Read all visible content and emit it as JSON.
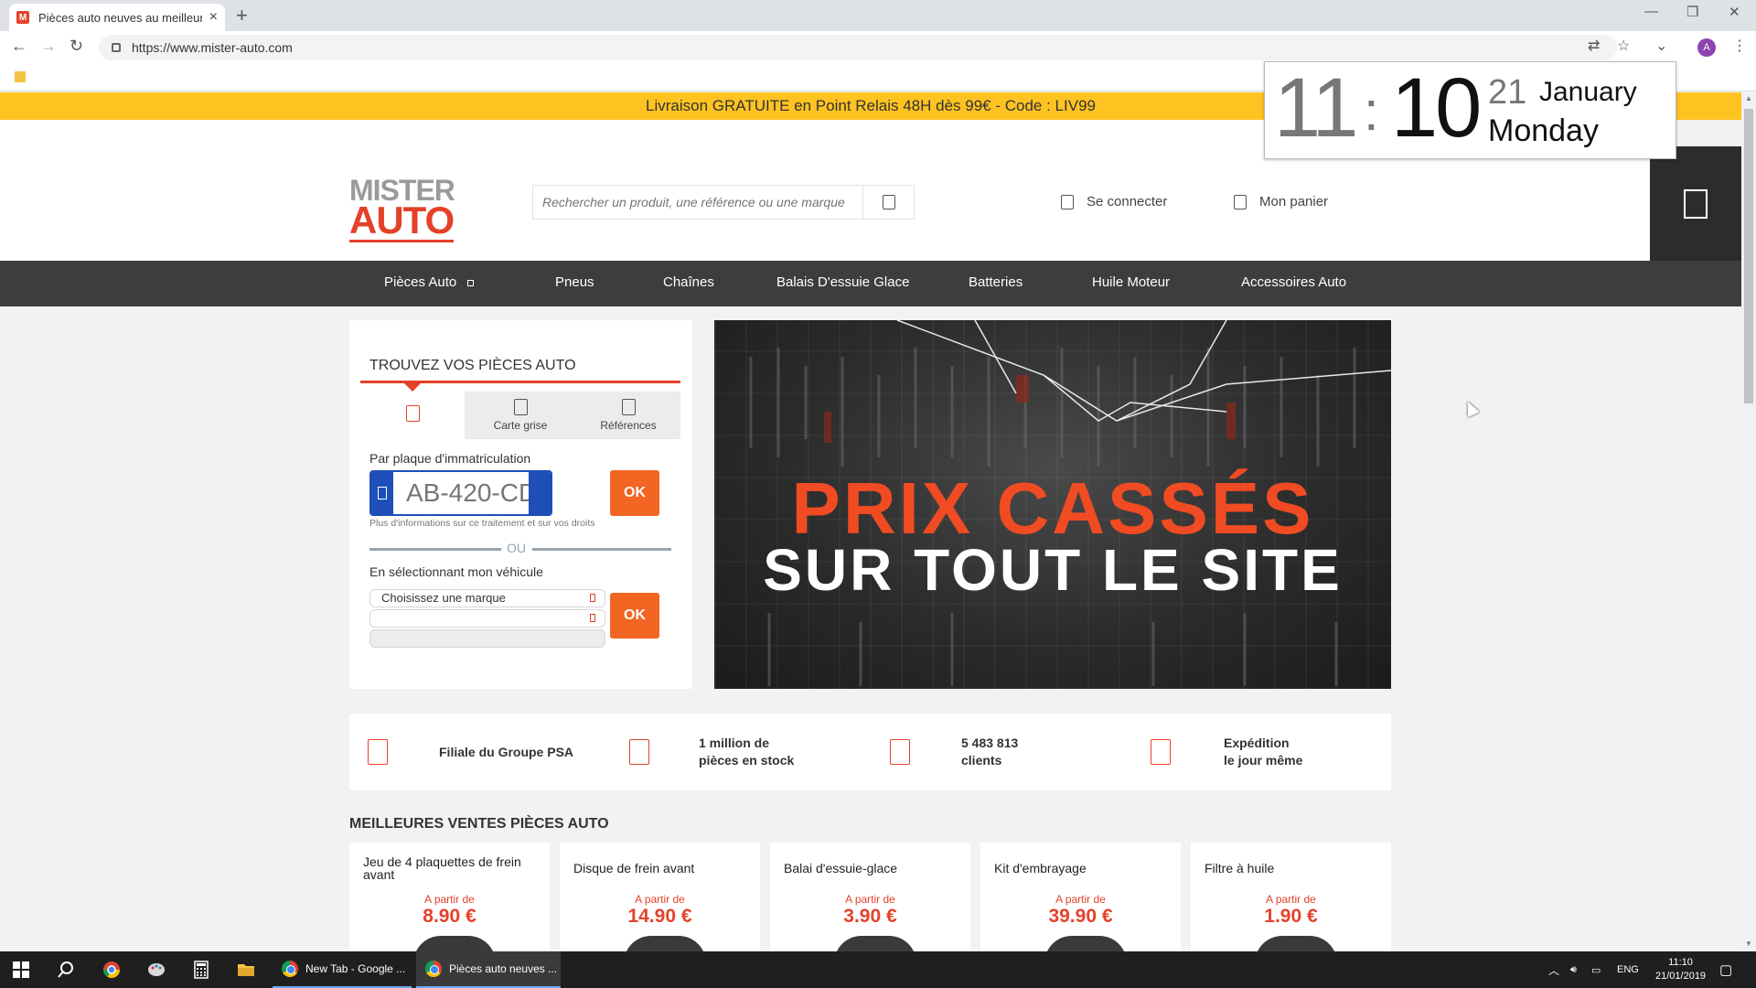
{
  "browser": {
    "tab_title": "Pièces auto neuves au meilleur p",
    "tab_favicon": "M",
    "url": "https://www.mister-auto.com",
    "profile_initial": "A"
  },
  "promo": {
    "text": "Livraison GRATUITE en Point Relais 48H dès 99€ - Code : LIV99"
  },
  "header": {
    "logo_line1": "MISTER",
    "logo_line2": "AUTO",
    "search_placeholder": "Rechercher un produit, une référence ou une marque",
    "login_label": "Se connecter",
    "cart_label": "Mon panier"
  },
  "nav": {
    "items": [
      "Pièces Auto",
      "Pneus",
      "Chaînes",
      "Balais D'essuie Glace",
      "Batteries",
      "Huile Moteur",
      "Accessoires Auto"
    ]
  },
  "finder": {
    "title": "TROUVEZ VOS PIÈCES AUTO",
    "tabs": [
      "",
      "Carte grise",
      "Références"
    ],
    "plate_label": "Par plaque d'immatriculation",
    "plate_placeholder": "AB-420-CD",
    "ok_label": "OK",
    "note": "Plus d'informations sur ce traitement et sur vos droits",
    "or_label": "OU",
    "vehicle_label": "En sélectionnant mon véhicule",
    "brand_select": "Choisissez une marque"
  },
  "banner": {
    "line1": "PRIX CASSÉS",
    "line2": "SUR TOUT LE SITE"
  },
  "trust": [
    {
      "line1": "Filiale du Groupe PSA",
      "line2": ""
    },
    {
      "line1": "1 million de",
      "line2": "pièces en stock"
    },
    {
      "line1": "5 483 813",
      "line2": "clients"
    },
    {
      "line1": "Expédition",
      "line2": "le jour même"
    }
  ],
  "best_sellers": {
    "title": "MEILLEURES VENTES PIÈCES AUTO",
    "from_label": "A partir de",
    "products": [
      {
        "name": "Jeu de 4 plaquettes de frein avant",
        "price": "8.90 €"
      },
      {
        "name": "Disque de frein avant",
        "price": "14.90 €"
      },
      {
        "name": "Balai d'essuie-glace",
        "price": "3.90 €"
      },
      {
        "name": "Kit d'embrayage",
        "price": "39.90 €"
      },
      {
        "name": "Filtre à huile",
        "price": "1.90 €"
      }
    ]
  },
  "clock": {
    "hours": "11",
    "separator": ":",
    "minutes": "10",
    "day": "21",
    "month": "January",
    "weekday": "Monday"
  },
  "taskbar": {
    "tasks": [
      "New Tab - Google ...",
      "Pièces auto neuves ..."
    ],
    "lang": "ENG",
    "time": "11:10",
    "date": "21/01/2019"
  },
  "colors": {
    "brand": "#e5412a",
    "promo": "#ffc321",
    "nav": "#3d3d3d",
    "ok": "#f26522"
  }
}
